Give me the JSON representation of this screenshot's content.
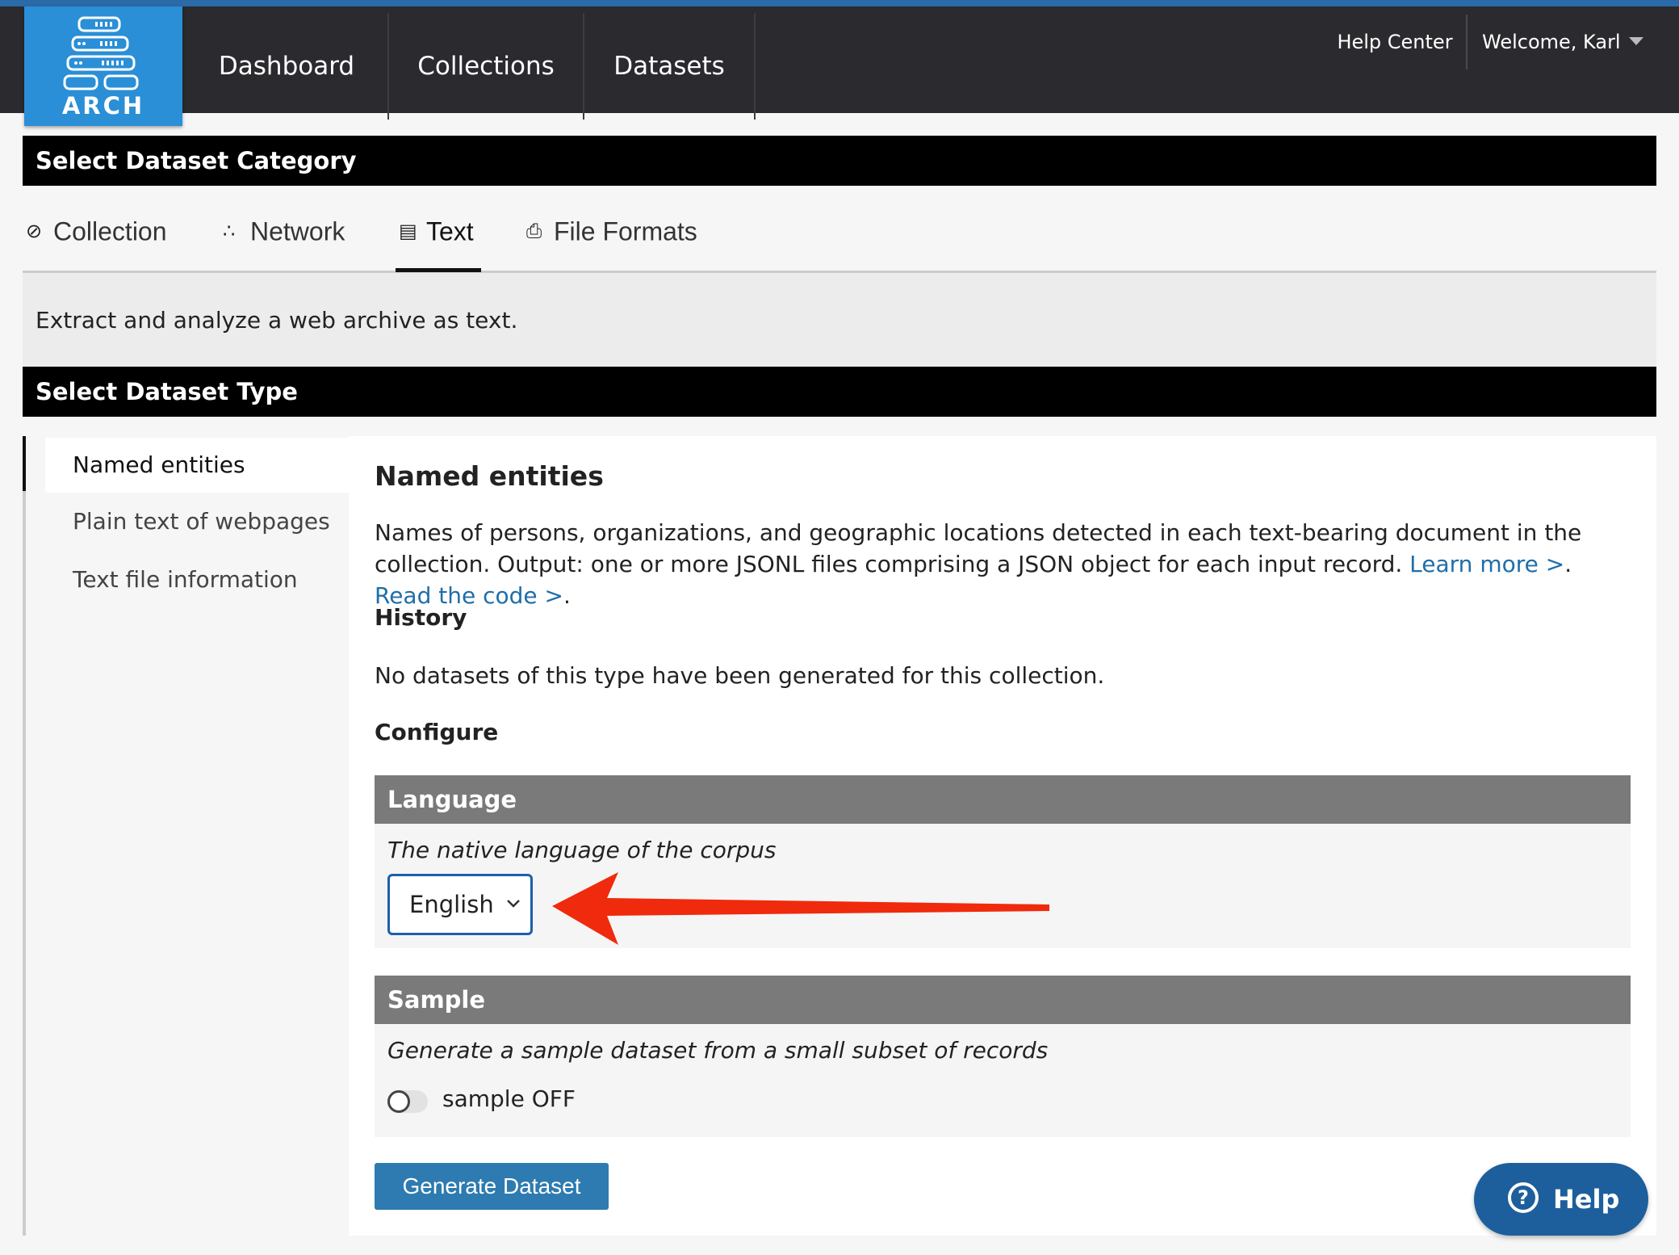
{
  "logo": {
    "text": "ARCH",
    "icon": "server-stack-icon"
  },
  "nav": {
    "links": [
      "Dashboard",
      "Collections",
      "Datasets"
    ],
    "help_center": "Help Center",
    "welcome": "Welcome, Karl"
  },
  "category": {
    "header": "Select Dataset Category",
    "tabs": [
      {
        "label": "Collection",
        "icon": "collection-icon"
      },
      {
        "label": "Network",
        "icon": "network-icon"
      },
      {
        "label": "Text",
        "icon": "text-document-icon"
      },
      {
        "label": "File Formats",
        "icon": "file-formats-icon"
      }
    ],
    "active_tab": "Text",
    "description": "Extract and analyze a web archive as text."
  },
  "type": {
    "header": "Select Dataset Type",
    "items": [
      "Named entities",
      "Plain text of webpages",
      "Text file information"
    ],
    "active_item": "Named entities"
  },
  "detail": {
    "title": "Named entities",
    "description": "Names of persons, organizations, and geographic locations detected in each text-bearing document in the collection. Output: one or more JSONL files comprising a JSON object for each input record.",
    "learn_more": "Learn more >",
    "sep": ".",
    "read_code": "Read the code >",
    "end": ".",
    "history_heading": "History",
    "history_text": "No datasets of this type have been generated for this collection.",
    "configure_heading": "Configure",
    "language": {
      "heading": "Language",
      "description": "The native language of the corpus",
      "selected": "English"
    },
    "sample": {
      "heading": "Sample",
      "description": "Generate a sample dataset from a small subset of records",
      "toggle_label": "sample OFF",
      "enabled": false
    },
    "generate_button": "Generate Dataset"
  },
  "help_button": {
    "label": "Help",
    "icon": "question-circle-icon"
  },
  "colors": {
    "nav_bg": "#2b2a2f",
    "logo_bg": "#2a8fd6",
    "accent_link": "#1f6ea8",
    "button_bg": "#2d7bb0",
    "help_bg": "#1d5f9c",
    "annotation_arrow": "#f02a0c"
  }
}
